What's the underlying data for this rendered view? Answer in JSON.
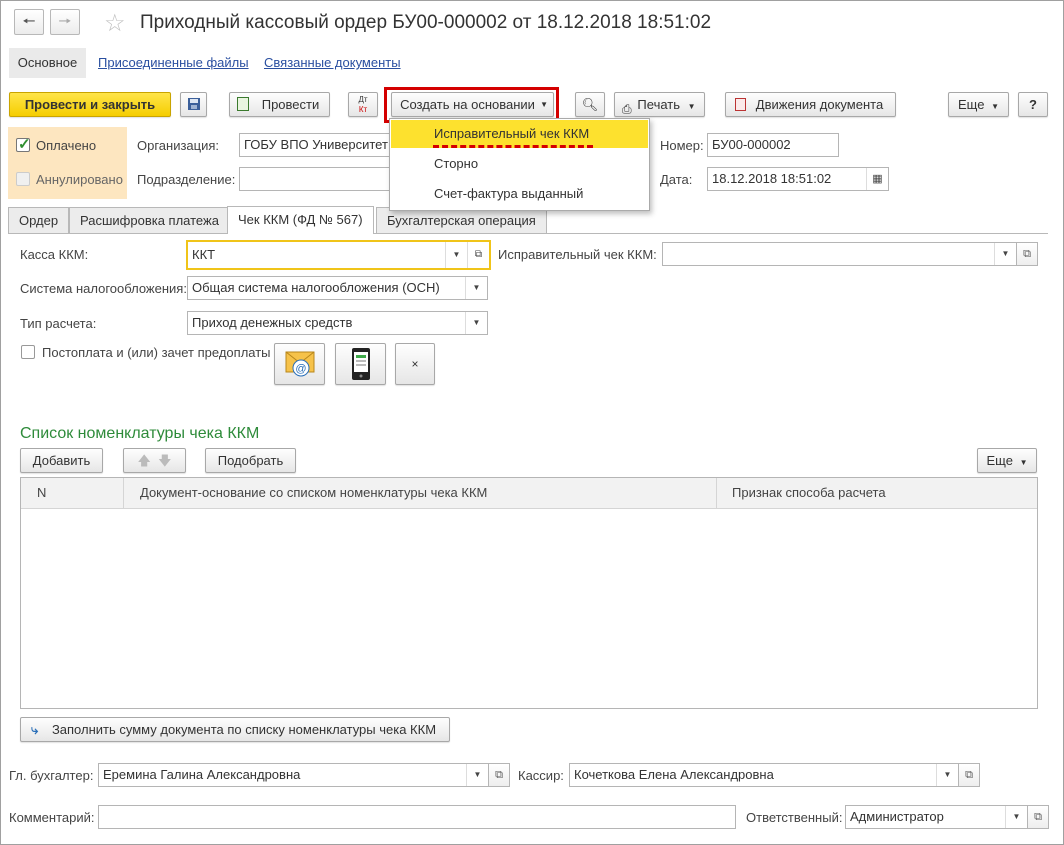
{
  "window": {
    "title": "Приходный кассовый ордер БУ00-000002 от 18.12.2018 18:51:02",
    "back_icon": "arrow-left-icon",
    "forward_icon": "arrow-right-icon",
    "star_icon": "star-icon"
  },
  "top_tabs": [
    "Основное",
    "Присоединенные файлы",
    "Связанные документы"
  ],
  "toolbar": {
    "post_close": "Провести и закрыть",
    "post": "Провести",
    "create_based": "Создать на основании",
    "print": "Печать",
    "movements": "Движения документа",
    "more": "Еще",
    "help": "?"
  },
  "dropdown_menu": {
    "items": [
      "Исправительный чек ККМ",
      "Сторно",
      "Счет-фактура выданный"
    ],
    "highlight_color": "#fde12e",
    "highlighted_index": 0
  },
  "header": {
    "paid_label": "Оплачено",
    "paid_checked": true,
    "canceled_label": "Аннулировано",
    "canceled_checked": false,
    "org_label": "Организация:",
    "org_value": "ГОБУ ВПО Университет",
    "dept_label": "Подразделение:",
    "dept_value": "",
    "number_label": "Номер:",
    "number_value": "БУ00-000002",
    "date_label": "Дата:",
    "date_value": "18.12.2018 18:51:02"
  },
  "doc_tabs": [
    "Ордер",
    "Расшифровка платежа",
    "Чек ККМ (ФД № 567)",
    "Бухгалтерская операция"
  ],
  "check_tab": {
    "kassa_label": "Касса ККМ:",
    "kassa_value": "ККТ",
    "corr_label": "Исправительный чек ККМ:",
    "corr_value": "",
    "tax_label": "Система налогообложения:",
    "tax_value": "Общая система налогообложения (ОСН)",
    "paytype_label": "Тип расчета:",
    "paytype_value": "Приход денежных средств",
    "postpay_label": "Постоплата и (или) зачет предоплаты",
    "postpay_checked": false,
    "email_icon": "email-icon",
    "phone_icon": "phone-icon",
    "clear_label": "×"
  },
  "list": {
    "title": "Список номенклатуры чека ККМ",
    "add": "Добавить",
    "pick": "Подобрать",
    "more": "Еще",
    "columns": [
      "N",
      "Документ-основание со списком номенклатуры чека ККМ",
      "Признак способа расчета"
    ],
    "rows": [],
    "fill_button": "Заполнить сумму документа по списку номенклатуры чека ККМ"
  },
  "footer": {
    "accountant_label": "Гл. бухгалтер:",
    "accountant_value": "Еремина Галина Александровна",
    "cashier_label": "Кассир:",
    "cashier_value": "Кочеткова Елена Александровна",
    "comment_label": "Комментарий:",
    "comment_value": "",
    "responsible_label": "Ответственный:",
    "responsible_value": "Администратор"
  },
  "colors": {
    "accent_yellow": "#f5cd00",
    "highlight_red": "#d40000",
    "link_blue": "#2a4fa0",
    "section_green": "#2e8b3a"
  }
}
